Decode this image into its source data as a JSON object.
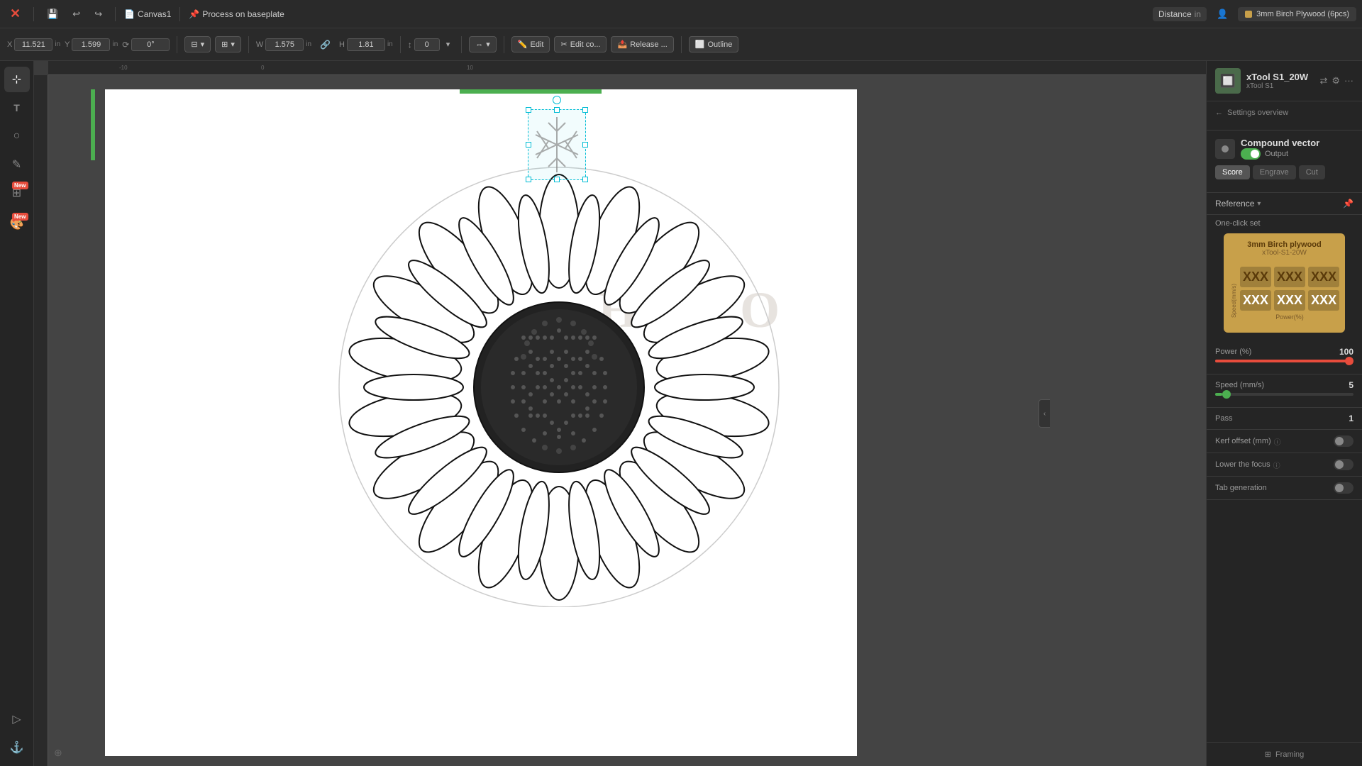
{
  "app": {
    "title": "Canvas1",
    "process_label": "Process on baseplate",
    "logo": "✕",
    "undo_icon": "↩",
    "redo_icon": "↪"
  },
  "topbar": {
    "distance_label": "Distance",
    "distance_unit": "in",
    "material_name": "3mm Birch Plywood (6pcs)"
  },
  "toolbar": {
    "x_label": "X",
    "x_value": "11.521",
    "y_label": "Y",
    "y_value": "1.599",
    "angle_value": "0°",
    "w_label": "W",
    "w_value": "1.575",
    "h_label": "H",
    "h_value": "1.81",
    "h2_value": "0",
    "unit": "in",
    "edit_label": "Edit",
    "edit_co_label": "Edit co...",
    "release_label": "Release ...",
    "outline_label": "Outline"
  },
  "left_sidebar": {
    "tools": [
      {
        "name": "select-tool",
        "icon": "⊹",
        "active": true
      },
      {
        "name": "text-tool",
        "icon": "T"
      },
      {
        "name": "shape-tool",
        "icon": "○"
      },
      {
        "name": "pen-tool",
        "icon": "✎"
      },
      {
        "name": "grid-tool",
        "icon": "⊞",
        "badge": "New"
      },
      {
        "name": "layers-tool",
        "icon": "≡",
        "badge": "New"
      },
      {
        "name": "navigate-tool",
        "icon": "▷"
      },
      {
        "name": "anchor-tool",
        "icon": "⊕"
      }
    ]
  },
  "canvas": {
    "hello_text": "HELLO",
    "ruler_ticks": [
      "-10",
      "0",
      "10"
    ]
  },
  "right_panel": {
    "device_name": "xTool S1_20W",
    "device_sub": "xTool S1",
    "settings_title": "Settings overview",
    "back_label": "Settings overview",
    "compound_name": "Compound vector",
    "output_label": "Output",
    "tabs": [
      "Score",
      "Engrave",
      "Cut"
    ],
    "active_tab": "Score",
    "reference_label": "Reference",
    "one_click_label": "One-click set",
    "material_card": {
      "title": "3mm Birch plywood",
      "subtitle": "xTool-S1-20W",
      "speed_label": "Speed(mm/s)",
      "cells": [
        "XXX",
        "XXX",
        "XXX",
        "XXX",
        "XXX",
        "XXX"
      ],
      "power_label": "Power(%)"
    },
    "power_label": "Power (%)",
    "power_value": "100",
    "speed_label": "Speed (mm/s)",
    "speed_value": "5",
    "pass_label": "Pass",
    "pass_value": "1",
    "kerf_label": "Kerf offset (mm)",
    "lower_focus_label": "Lower the focus",
    "tab_gen_label": "Tab generation",
    "framing_label": "Framing"
  }
}
